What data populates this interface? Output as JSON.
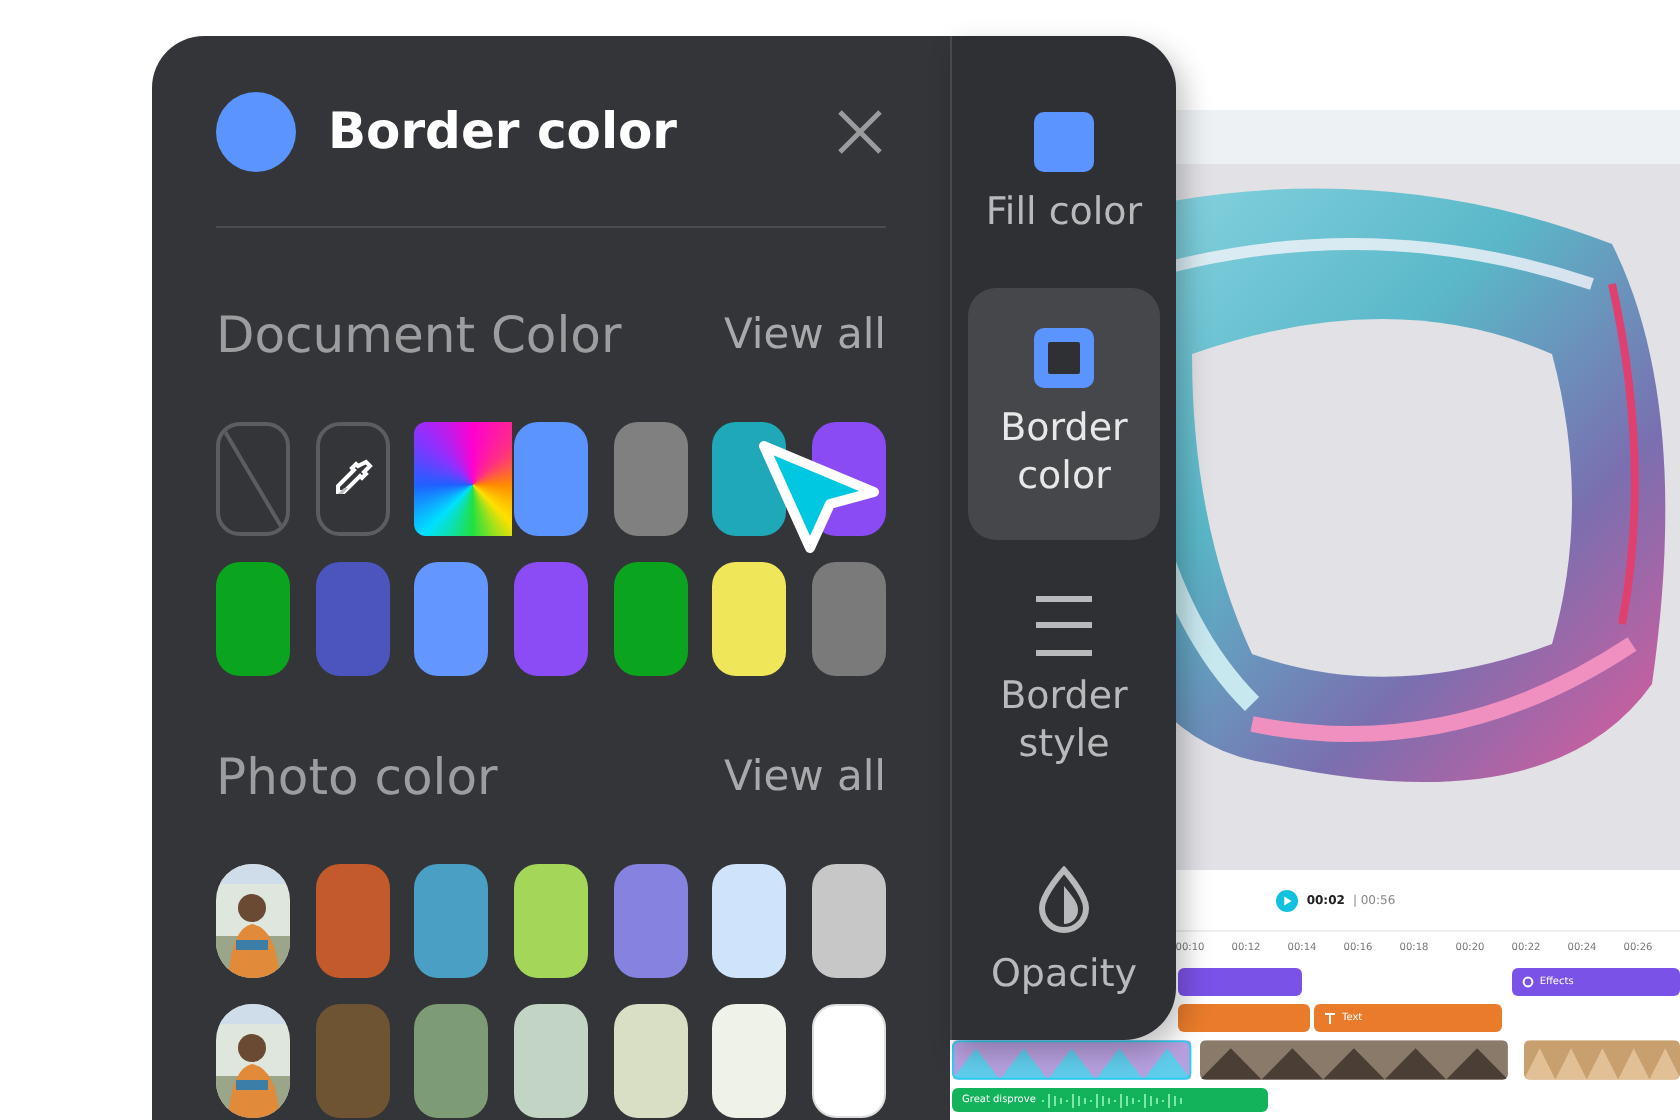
{
  "panel": {
    "title": "Border color",
    "sections": [
      {
        "title": "Document Color",
        "link": "View all",
        "swatches": [
          {
            "kind": "none"
          },
          {
            "kind": "picker"
          },
          {
            "kind": "spectrum"
          },
          {
            "kind": "color",
            "color": "#5b93ff"
          },
          {
            "kind": "color",
            "color": "#808080"
          },
          {
            "kind": "color",
            "color": "#1fa8b8"
          },
          {
            "kind": "color",
            "color": "#8a4bf5"
          },
          {
            "kind": "color",
            "color": "#0aa41f"
          },
          {
            "kind": "color",
            "color": "#4b55bd"
          },
          {
            "kind": "color",
            "color": "#6397ff"
          },
          {
            "kind": "color",
            "color": "#8b4cf5"
          },
          {
            "kind": "color",
            "color": "#0aa41f"
          },
          {
            "kind": "color",
            "color": "#efe65a"
          },
          {
            "kind": "color",
            "color": "#7a7a7a"
          }
        ]
      },
      {
        "title": "Photo color",
        "link": "View all",
        "swatches": [
          {
            "kind": "picture"
          },
          {
            "kind": "color",
            "color": "#c25a2c"
          },
          {
            "kind": "color",
            "color": "#4aa0c4"
          },
          {
            "kind": "color",
            "color": "#a4d65a"
          },
          {
            "kind": "color",
            "color": "#8582e0"
          },
          {
            "kind": "color",
            "color": "#cfe4fb"
          },
          {
            "kind": "color",
            "color": "#c7c7c7"
          },
          {
            "kind": "picture"
          },
          {
            "kind": "color",
            "color": "#6e5432"
          },
          {
            "kind": "color",
            "color": "#7d9b74"
          },
          {
            "kind": "color",
            "color": "#c2d4c4"
          },
          {
            "kind": "color",
            "color": "#d8dfc5"
          },
          {
            "kind": "color",
            "color": "#eef2e8"
          },
          {
            "kind": "color",
            "color": "#ffffff"
          }
        ]
      }
    ]
  },
  "sidebar": {
    "items": [
      {
        "kind": "fill",
        "label": "Fill color",
        "selected": false
      },
      {
        "kind": "border",
        "label": "Border color",
        "selected": true
      },
      {
        "kind": "style",
        "label": "Border style",
        "selected": false
      },
      {
        "kind": "opacity",
        "label": "Opacity",
        "selected": false
      }
    ]
  },
  "timeline": {
    "current": "00:02",
    "total": "| 00:56",
    "ticks": [
      "00:10",
      "00:12",
      "00:14",
      "00:16",
      "00:18",
      "00:20",
      "00:22",
      "00:24",
      "00:26"
    ],
    "effects_clip": "Effects",
    "text_clip": "Text",
    "audio_clip": "Great disprove"
  }
}
